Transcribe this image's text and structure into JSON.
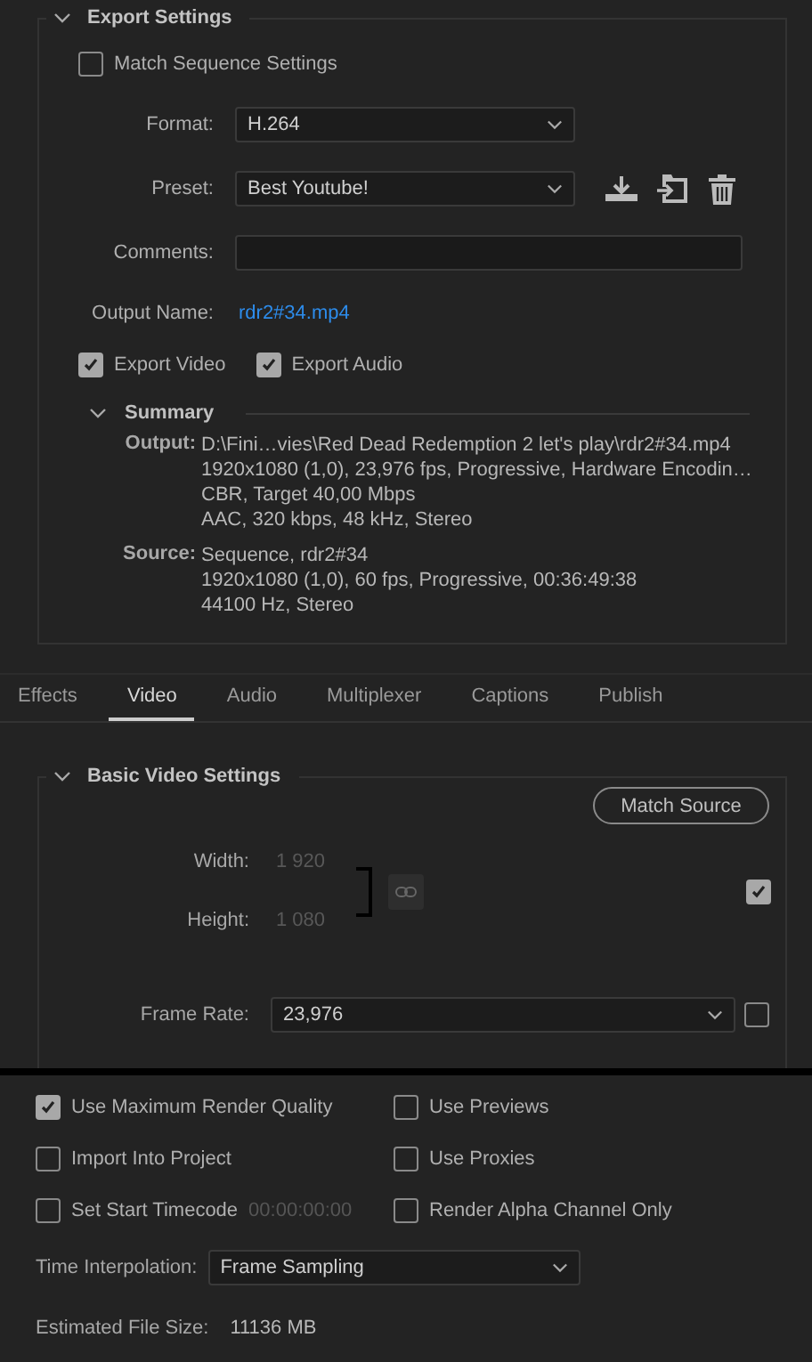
{
  "export_settings": {
    "title": "Export Settings",
    "expanded": true,
    "match_sequence": {
      "label": "Match Sequence Settings",
      "checked": false
    },
    "format": {
      "label": "Format:",
      "value": "H.264"
    },
    "preset": {
      "label": "Preset:",
      "value": "Best Youtube!"
    },
    "comments": {
      "label": "Comments:"
    },
    "output_name": {
      "label": "Output Name:",
      "value": "rdr2#34.mp4"
    },
    "export_options": [
      {
        "label": "Export Video",
        "checked": true
      },
      {
        "label": "Export Audio",
        "checked": true
      }
    ],
    "summary": {
      "title": "Summary",
      "expanded": true,
      "sections": [
        {
          "label": "Output:",
          "lines": [
            "D:\\Fini…vies\\Red Dead Redemption 2 let's play\\rdr2#34.mp4",
            "1920x1080 (1,0), 23,976 fps, Progressive, Hardware Encodin…",
            "CBR, Target 40,00 Mbps",
            "AAC, 320 kbps, 48 kHz, Stereo"
          ]
        },
        {
          "label": "Source:",
          "lines": [
            "Sequence, rdr2#34",
            "1920x1080 (1,0), 60 fps, Progressive, 00:36:49:38",
            "44100 Hz, Stereo"
          ]
        }
      ]
    }
  },
  "tabs": [
    {
      "label": "Effects",
      "selected": false
    },
    {
      "label": "Video",
      "selected": true
    },
    {
      "label": "Audio",
      "selected": false
    },
    {
      "label": "Multiplexer",
      "selected": false
    },
    {
      "label": "Captions",
      "selected": false
    },
    {
      "label": "Publish",
      "selected": false
    }
  ],
  "basic_video": {
    "title": "Basic Video Settings",
    "expanded": true,
    "match_button": "Match Source",
    "width": {
      "label": "Width:",
      "value": "1 920"
    },
    "height": {
      "label": "Height:",
      "value": "1 080"
    },
    "match_checked": true,
    "frame_rate": {
      "label": "Frame Rate:",
      "value": "23,976",
      "checked": false
    }
  },
  "options": [
    {
      "label": "Use Maximum Render Quality",
      "checked": true
    },
    {
      "label": "Use Previews",
      "checked": false
    },
    {
      "label": "Import Into Project",
      "checked": false
    },
    {
      "label": "Use Proxies",
      "checked": false
    },
    {
      "label": "Set Start Timecode",
      "checked": false,
      "timecode": "00:00:00:00"
    },
    {
      "label": "Render Alpha Channel Only",
      "checked": false
    }
  ],
  "time_interpolation": {
    "label": "Time Interpolation:",
    "value": "Frame Sampling"
  },
  "estimated_size": {
    "label": "Estimated File Size:",
    "value": "11136 MB"
  }
}
